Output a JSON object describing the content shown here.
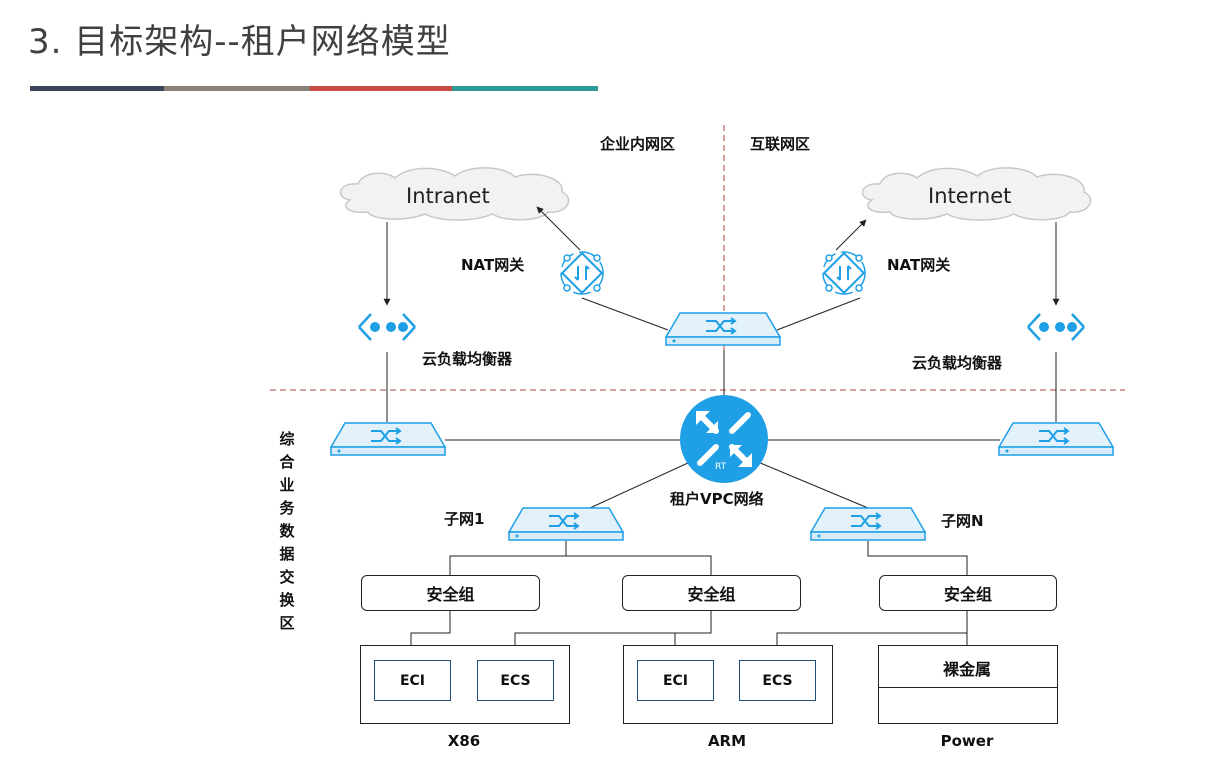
{
  "title": "3. 目标架构--租户网络模型",
  "title_bar_colors": [
    "#3b4458",
    "#8a8278",
    "#c84b44",
    "#2e9a95"
  ],
  "zones": {
    "intranet_zone": "企业内网区",
    "internet_zone": "互联网区",
    "exchange_zone": "综合业务数据交换区"
  },
  "clouds": {
    "intranet": "Intranet",
    "internet": "Internet"
  },
  "labels": {
    "nat_left": "NAT网关",
    "nat_right": "NAT网关",
    "lb_left": "云负载均衡器",
    "lb_right": "云负载均衡器",
    "router_text": "RT",
    "vpc": "租户VPC网络",
    "subnet_1": "子网1",
    "subnet_n": "子网N"
  },
  "security_groups": [
    "安全组",
    "安全组",
    "安全组"
  ],
  "groups": {
    "x86": {
      "items": [
        "ECI",
        "ECS"
      ],
      "footer": "X86"
    },
    "arm": {
      "items": [
        "ECI",
        "ECS"
      ],
      "footer": "ARM"
    },
    "power": {
      "header": "裸金属",
      "footer": "Power"
    }
  },
  "colors": {
    "icon_blue": "#1e9fe6",
    "switch_fill": "#e3f1fb",
    "divider": "#b0413e"
  }
}
